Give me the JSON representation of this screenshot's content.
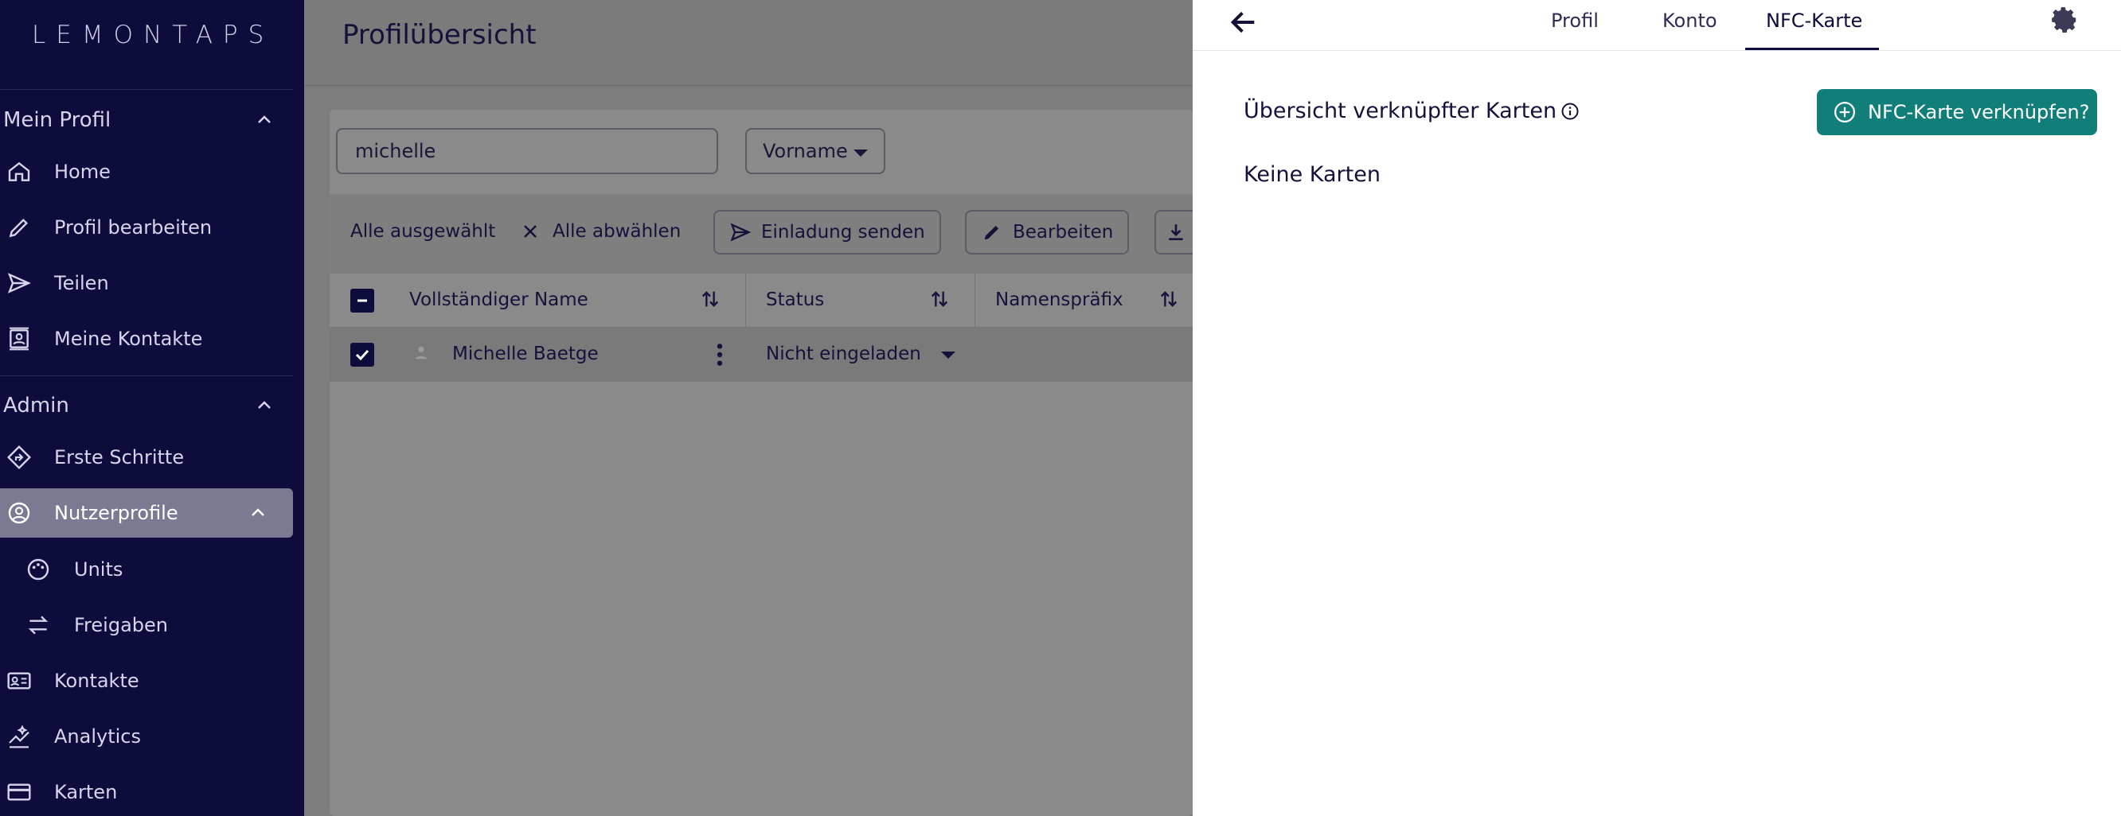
{
  "sidebar": {
    "logo": "LEMONTAPS",
    "sections": {
      "profile": "Mein Profil",
      "admin": "Admin"
    },
    "items": [
      {
        "label": "Home",
        "icon": "home-icon"
      },
      {
        "label": "Profil bearbeiten",
        "icon": "pencil-icon"
      },
      {
        "label": "Teilen",
        "icon": "send-icon"
      },
      {
        "label": "Meine Kontakte",
        "icon": "contacts-icon"
      },
      {
        "label": "Erste Schritte",
        "icon": "directions-icon"
      },
      {
        "label": "Nutzerprofile",
        "icon": "user-circle-icon"
      },
      {
        "label": "Units",
        "icon": "palette-icon"
      },
      {
        "label": "Freigaben",
        "icon": "swap-icon"
      },
      {
        "label": "Kontakte",
        "icon": "contact-card-icon"
      },
      {
        "label": "Analytics",
        "icon": "analytics-icon"
      },
      {
        "label": "Karten",
        "icon": "credit-card-icon"
      }
    ]
  },
  "main": {
    "title": "Profilübersicht",
    "search": {
      "value": "michelle"
    },
    "filter": {
      "selected": "Vorname"
    },
    "toolbar": {
      "all_selected": "Alle ausgewählt",
      "deselect_all": "Alle abwählen",
      "invite": "Einladung senden",
      "edit": "Bearbeiten"
    },
    "table": {
      "headers": [
        "Vollständiger Name",
        "Status",
        "Namenspräfix"
      ],
      "rows": [
        {
          "name": "Michelle Baetge",
          "status": "Nicht eingeladen"
        }
      ]
    }
  },
  "panel": {
    "tabs": [
      "Profil",
      "Konto",
      "NFC-Karte"
    ],
    "active_tab": "NFC-Karte",
    "section_title": "Übersicht verknüpfter Karten",
    "link_button": "NFC-Karte verknüpfen?",
    "empty_text": "Keine Karten",
    "accent": "#127e7a"
  }
}
